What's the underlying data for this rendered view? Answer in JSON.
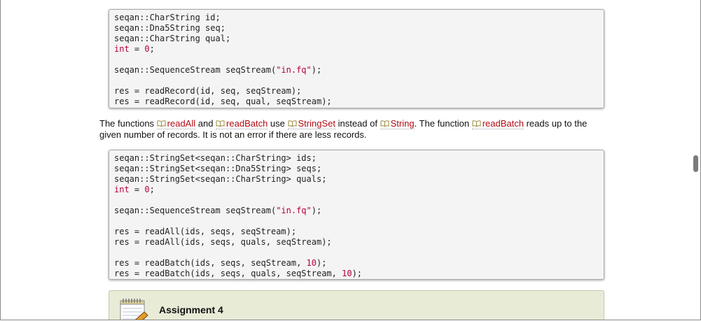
{
  "code_block_1": {
    "lines": [
      [
        {
          "t": "seqan::CharString id;"
        }
      ],
      [
        {
          "t": "seqan::Dna5String seq;"
        }
      ],
      [
        {
          "t": "seqan::CharString qual;"
        }
      ],
      [
        {
          "t": "int",
          "c": "kw"
        },
        {
          "t": " = "
        },
        {
          "t": "0",
          "c": "num"
        },
        {
          "t": ";"
        }
      ],
      [],
      [
        {
          "t": "seqan::SequenceStream seqStream("
        },
        {
          "t": "\"in.fq\"",
          "c": "str"
        },
        {
          "t": ");"
        }
      ],
      [],
      [
        {
          "t": "res = readRecord(id, seq, seqStream);"
        }
      ],
      [
        {
          "t": "res = readRecord(id, seq, qual, seqStream);"
        }
      ]
    ]
  },
  "paragraph": {
    "t1": "The functions ",
    "link1": "readAll",
    "t2": " and ",
    "link2": "readBatch",
    "t3": " use ",
    "link3": "StringSet",
    "t4": " instead of ",
    "link4": "String",
    "t5": ". The function ",
    "link5": "readBatch",
    "t6": " reads up to the given number of records. It is not an error if there are less records."
  },
  "code_block_2": {
    "lines": [
      [
        {
          "t": "seqan::StringSet<seqan::CharString> ids;"
        }
      ],
      [
        {
          "t": "seqan::StringSet<seqan::Dna5String> seqs;"
        }
      ],
      [
        {
          "t": "seqan::StringSet<seqan::CharString> quals;"
        }
      ],
      [
        {
          "t": "int",
          "c": "kw"
        },
        {
          "t": " = "
        },
        {
          "t": "0",
          "c": "num"
        },
        {
          "t": ";"
        }
      ],
      [],
      [
        {
          "t": "seqan::SequenceStream seqStream("
        },
        {
          "t": "\"in.fq\"",
          "c": "str"
        },
        {
          "t": ");"
        }
      ],
      [],
      [
        {
          "t": "res = readAll(ids, seqs, seqStream);"
        }
      ],
      [
        {
          "t": "res = readAll(ids, seqs, quals, seqStream);"
        }
      ],
      [],
      [
        {
          "t": "res = readBatch(ids, seqs, seqStream, "
        },
        {
          "t": "10",
          "c": "num"
        },
        {
          "t": ");"
        }
      ],
      [
        {
          "t": "res = readBatch(ids, seqs, quals, seqStream, "
        },
        {
          "t": "10",
          "c": "num"
        },
        {
          "t": ");"
        }
      ]
    ]
  },
  "assignment": {
    "title": "Assignment 4",
    "icon": "notepad-pencil-icon"
  },
  "icons": {
    "link_icon": "book-icon"
  },
  "colors": {
    "link": "#b20a14",
    "keyword": "#b5003c",
    "assignment_bg": "#e8ebd6"
  }
}
